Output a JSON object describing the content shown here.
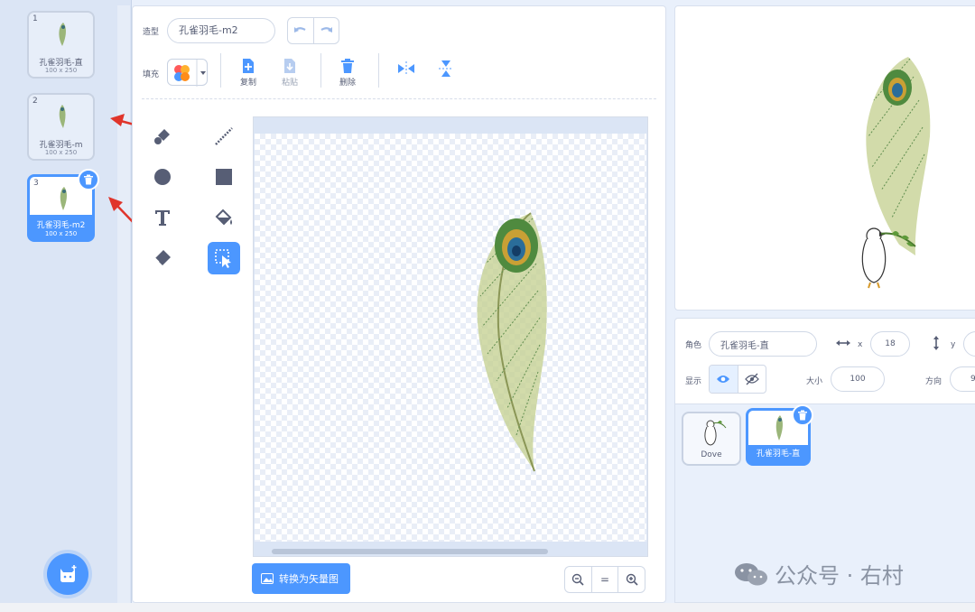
{
  "costumes": [
    {
      "number": "1",
      "name": "孔雀羽毛-直",
      "size": "100 x 250",
      "selected": false
    },
    {
      "number": "2",
      "name": "孔雀羽毛-m",
      "size": "100 x 250",
      "selected": false
    },
    {
      "number": "3",
      "name": "孔雀羽毛-m2",
      "size": "100 x 250",
      "selected": true
    }
  ],
  "editor": {
    "costume_label": "造型",
    "costume_name": "孔雀羽毛-m2",
    "fill_label": "填充",
    "copy_label": "复制",
    "paste_label": "粘贴",
    "delete_label": "删除",
    "convert_label": "转换为矢量图",
    "zoom_reset": "="
  },
  "sprite_info": {
    "sprite_label": "角色",
    "sprite_name": "孔雀羽毛-直",
    "x_label": "x",
    "x_value": "18",
    "y_label": "y",
    "show_label": "显示",
    "size_label": "大小",
    "size_value": "100",
    "direction_label": "方向",
    "direction_value": "9"
  },
  "sprites": [
    {
      "name": "Dove",
      "selected": false
    },
    {
      "name": "孔雀羽毛-直",
      "selected": true
    }
  ],
  "watermark": {
    "text": "公众号 · 右村"
  },
  "colors": {
    "accent": "#4c97ff",
    "panel": "#e9f0fb",
    "text": "#575e75"
  }
}
